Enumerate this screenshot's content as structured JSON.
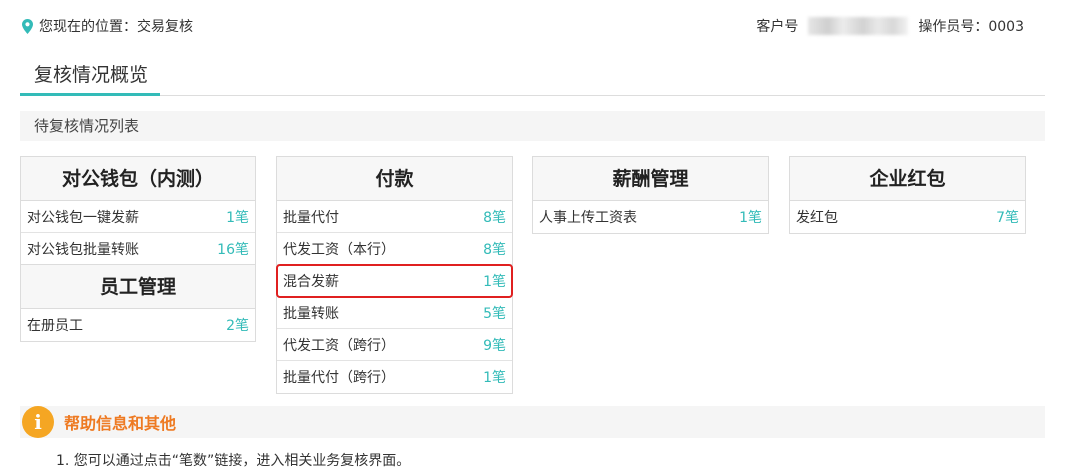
{
  "header": {
    "location_label": "您现在的位置：交易复核",
    "customer_label": "客户号",
    "operator_label": "操作员号：0003"
  },
  "tabs": [
    {
      "label": "复核情况概览"
    }
  ],
  "section_title": "待复核情况列表",
  "cards": {
    "corp_wallet": {
      "title": "对公钱包（内测）",
      "rows": [
        {
          "label": "对公钱包一键发薪",
          "count": "1笔"
        },
        {
          "label": "对公钱包批量转账",
          "count": "16笔"
        }
      ]
    },
    "staff": {
      "title": "员工管理",
      "rows": [
        {
          "label": "在册员工",
          "count": "2笔"
        }
      ]
    },
    "payment": {
      "title": "付款",
      "rows": [
        {
          "label": "批量代付",
          "count": "8笔"
        },
        {
          "label": "代发工资（本行）",
          "count": "8笔"
        },
        {
          "label": "混合发薪",
          "count": "1笔"
        },
        {
          "label": "批量转账",
          "count": "5笔"
        },
        {
          "label": "代发工资（跨行）",
          "count": "9笔"
        },
        {
          "label": "批量代付（跨行）",
          "count": "1笔"
        }
      ]
    },
    "salary": {
      "title": "薪酬管理",
      "rows": [
        {
          "label": "人事上传工资表",
          "count": "1笔"
        }
      ]
    },
    "red_packet": {
      "title": "企业红包",
      "rows": [
        {
          "label": "发红包",
          "count": "7笔"
        }
      ]
    }
  },
  "help": {
    "icon": "info-icon",
    "icon_glyph": "i",
    "title": "帮助信息和其他",
    "items": [
      "1. 您可以通过点击“笔数”链接，进入相关业务复核界面。"
    ]
  },
  "colors": {
    "accent": "#33bbb8",
    "highlight": "#e02020",
    "help_title": "#ee7a22",
    "help_icon": "#f5a623"
  }
}
